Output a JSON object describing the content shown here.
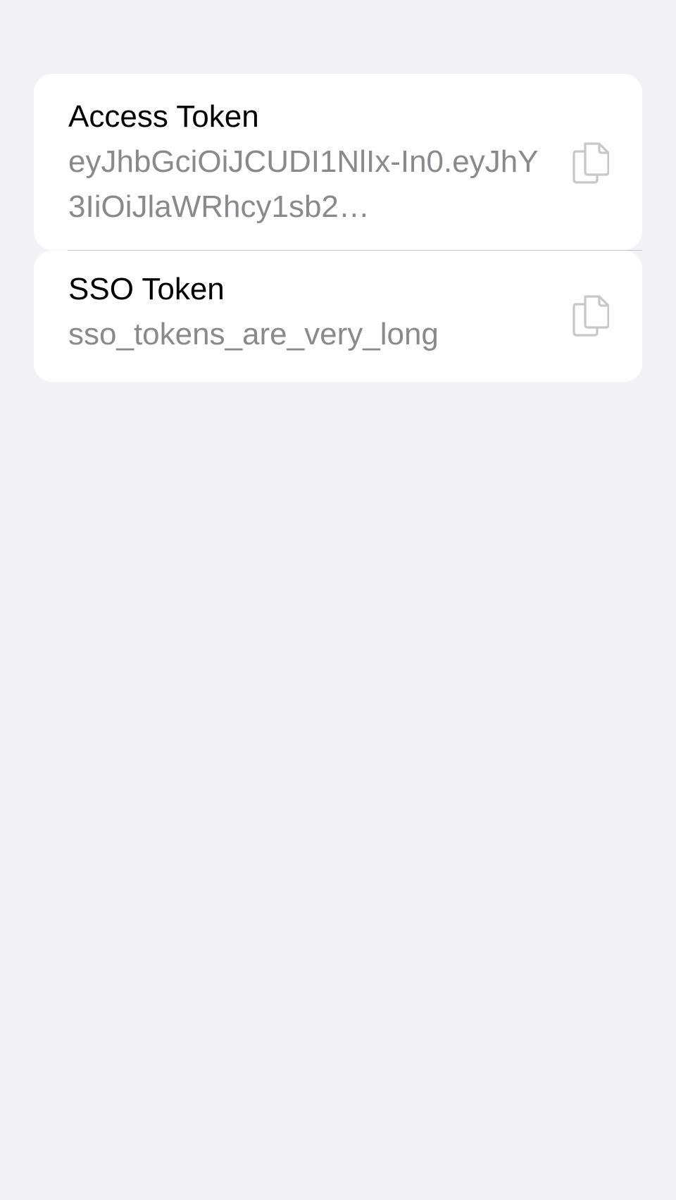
{
  "tokens": [
    {
      "title": "Access Token",
      "value": "eyJhbGciOiJCUDI1NlIx-In0.eyJhY3IiOiJlaWRhcy1sb2…",
      "action_icon": "copy-icon"
    },
    {
      "title": "SSO Token",
      "value": "sso_tokens_are_very_long",
      "action_icon": "copy-icon"
    }
  ],
  "colors": {
    "background": "#f2f2f7",
    "card": "#ffffff",
    "title": "#000000",
    "value": "#8a8a8e",
    "icon": "#c7c7cc",
    "separator": "#c6c6c8"
  }
}
